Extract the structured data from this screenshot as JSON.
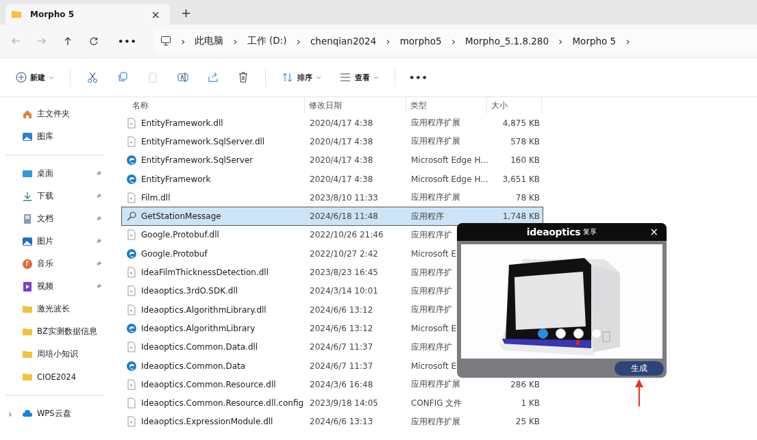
{
  "window": {
    "tabs": [
      {
        "title": "Morpho 5",
        "selected": true,
        "close": "×"
      }
    ],
    "new_tab": "+"
  },
  "address_bar": {
    "more": "•••",
    "crumbs": [
      "此电脑",
      "工作 (D:)",
      "chenqian2024",
      "morpho5",
      "Morpho_5.1.8.280",
      "Morpho 5"
    ],
    "separator": "›"
  },
  "toolbar": {
    "new": "新建",
    "sort": "排序",
    "view": "查看",
    "more": "•••",
    "paste_disabled": true
  },
  "sidebar": {
    "groups": [
      [
        {
          "kind": "home",
          "label": "主文件夹",
          "pinned": false
        },
        {
          "kind": "gallery",
          "label": "图库",
          "pinned": false
        }
      ],
      [
        {
          "kind": "desktop",
          "label": "桌面",
          "pinned": true
        },
        {
          "kind": "download",
          "label": "下载",
          "pinned": true
        },
        {
          "kind": "docs",
          "label": "文档",
          "pinned": true
        },
        {
          "kind": "pictures",
          "label": "图片",
          "pinned": true
        },
        {
          "kind": "music",
          "label": "音乐",
          "pinned": true
        },
        {
          "kind": "video",
          "label": "视频",
          "pinned": true
        },
        {
          "kind": "folder",
          "label": "激光波长",
          "pinned": false
        },
        {
          "kind": "folder",
          "label": "BZ实测数据信息",
          "pinned": false
        },
        {
          "kind": "folder",
          "label": "周培小知识",
          "pinned": false
        },
        {
          "kind": "folder",
          "label": "CIOE2024",
          "pinned": false
        }
      ],
      [
        {
          "kind": "cloud",
          "label": "WPS云盘",
          "pinned": false,
          "expander": "›"
        }
      ]
    ]
  },
  "table": {
    "columns": [
      "名称",
      "修改日期",
      "类型",
      "大小"
    ],
    "rows": [
      {
        "kind": "dll",
        "name": "EntityFramework.dll",
        "date": "2020/4/17 4:38",
        "type": "应用程序扩展",
        "size": "4,875 KB",
        "selected": false
      },
      {
        "kind": "dll",
        "name": "EntityFramework.SqlServer.dll",
        "date": "2020/4/17 4:38",
        "type": "应用程序扩展",
        "size": "578 KB",
        "selected": false
      },
      {
        "kind": "edge",
        "name": "EntityFramework.SqlServer",
        "date": "2020/4/17 4:38",
        "type": "Microsoft Edge H...",
        "size": "160 KB",
        "selected": false
      },
      {
        "kind": "edge",
        "name": "EntityFramework",
        "date": "2020/4/17 4:38",
        "type": "Microsoft Edge H...",
        "size": "3,651 KB",
        "selected": false
      },
      {
        "kind": "dll",
        "name": "Film.dll",
        "date": "2023/8/10 11:33",
        "type": "应用程序扩展",
        "size": "78 KB",
        "selected": false
      },
      {
        "kind": "app",
        "name": "GetStationMessage",
        "date": "2024/6/18 11:48",
        "type": "应用程序",
        "size": "1,748 KB",
        "selected": true
      },
      {
        "kind": "dll",
        "name": "Google.Protobuf.dll",
        "date": "2022/10/26 21:46",
        "type": "应用程序扩",
        "selected": false
      },
      {
        "kind": "edge",
        "name": "Google.Protobuf",
        "date": "2022/10/27 2:42",
        "type": "Microsoft E",
        "selected": false
      },
      {
        "kind": "dll",
        "name": "IdeaFilmThicknessDetection.dll",
        "date": "2023/8/23 16:45",
        "type": "应用程序扩",
        "selected": false
      },
      {
        "kind": "dll",
        "name": "Ideaoptics.3rdO.SDK.dll",
        "date": "2024/3/14 10:01",
        "type": "应用程序扩",
        "selected": false
      },
      {
        "kind": "dll",
        "name": "Ideaoptics.AlgorithmLibrary.dll",
        "date": "2024/6/6 13:12",
        "type": "应用程序扩",
        "selected": false
      },
      {
        "kind": "edge",
        "name": "Ideaoptics.AlgorithmLibrary",
        "date": "2024/6/6 13:12",
        "type": "Microsoft E",
        "selected": false
      },
      {
        "kind": "dll",
        "name": "Ideaoptics.Common.Data.dll",
        "date": "2024/6/7 11:37",
        "type": "应用程序扩",
        "selected": false
      },
      {
        "kind": "edge",
        "name": "Ideaoptics.Common.Data",
        "date": "2024/6/7 11:37",
        "type": "Microsoft E",
        "selected": false
      },
      {
        "kind": "dll",
        "name": "Ideaoptics.Common.Resource.dll",
        "date": "2024/3/6 16:48",
        "type": "应用程序扩展",
        "size": "286 KB",
        "selected": false
      },
      {
        "kind": "config",
        "name": "Ideaoptics.Common.Resource.dll.config",
        "date": "2023/9/18 14:05",
        "type": "CONFIG 文件",
        "size": "1 KB",
        "selected": false
      },
      {
        "kind": "dll",
        "name": "Ideaoptics.ExpressionModule.dll",
        "date": "2024/6/6 13:13",
        "type": "应用程序扩展",
        "size": "25 KB",
        "selected": false
      }
    ]
  },
  "dialog": {
    "logo": "ideaoptics",
    "logo_sub": "复享",
    "close": "×",
    "dots": [
      {
        "selected": true
      },
      {
        "selected": false
      },
      {
        "selected": false
      },
      {
        "selected": false
      }
    ],
    "button": "生成"
  }
}
